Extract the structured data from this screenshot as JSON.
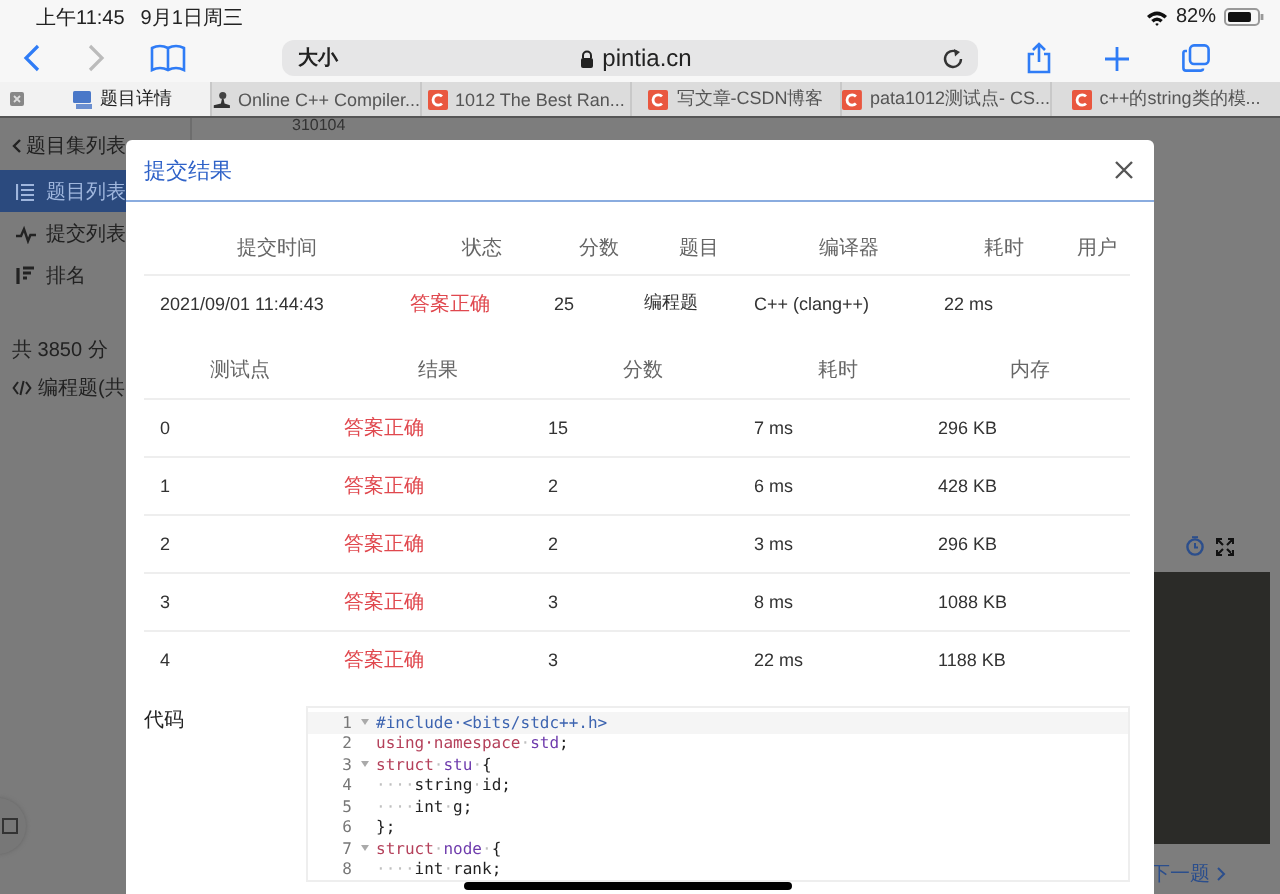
{
  "status_bar": {
    "time": "上午11:45",
    "date": "9月1日周三",
    "battery": "82%"
  },
  "browser": {
    "text_size": "大小",
    "address": "pintia.cn",
    "tabs": [
      {
        "title": "题目详情",
        "selected": true,
        "kind": "computer"
      },
      {
        "title": "Online C++ Compiler...",
        "selected": false,
        "kind": "figure"
      },
      {
        "title": "1012 The Best Ran...",
        "selected": false,
        "kind": "c"
      },
      {
        "title": "写文章-CSDN博客",
        "selected": false,
        "kind": "c"
      },
      {
        "title": "pata1012测试点- CS...",
        "selected": false,
        "kind": "c"
      },
      {
        "title": "c++的string类的模...",
        "selected": false,
        "kind": "c"
      }
    ]
  },
  "page": {
    "back_link": "题目集列表",
    "background_text": "310104",
    "sidebar": [
      {
        "label": "题目列表",
        "selected": true,
        "kind": "list"
      },
      {
        "label": "提交列表",
        "selected": false,
        "kind": "pulse"
      },
      {
        "label": "排名",
        "selected": false,
        "kind": "bars"
      }
    ],
    "total": "共 3850 分",
    "category": "编程题(共",
    "next": "下一题"
  },
  "modal": {
    "title": "提交结果",
    "summary": {
      "columns": [
        "提交时间",
        "状态",
        "分数",
        "题目",
        "编译器",
        "耗时",
        "用户"
      ],
      "row": [
        "2021/09/01 11:44:43",
        "答案正确",
        "25",
        "编程题",
        "C++ (clang++)",
        "22 ms"
      ]
    },
    "cases": {
      "columns": [
        "测试点",
        "结果",
        "分数",
        "耗时",
        "内存"
      ],
      "rows": [
        [
          "0",
          "答案正确",
          "15",
          "7 ms",
          "296 KB"
        ],
        [
          "1",
          "答案正确",
          "2",
          "6 ms",
          "428 KB"
        ],
        [
          "2",
          "答案正确",
          "2",
          "3 ms",
          "296 KB"
        ],
        [
          "3",
          "答案正确",
          "3",
          "8 ms",
          "1088 KB"
        ],
        [
          "4",
          "答案正确",
          "3",
          "22 ms",
          "1188 KB"
        ]
      ]
    },
    "code_label": "代码",
    "code": [
      {
        "number": "1",
        "foldable": true,
        "tokens": [
          {
            "kind": "directive",
            "text": "#include·<bits/stdc++.h>"
          }
        ]
      },
      {
        "number": "2",
        "foldable": false,
        "tokens": [
          {
            "kind": "keyword",
            "text": "using·namespace"
          },
          {
            "kind": "space",
            "text": "·"
          },
          {
            "kind": "name",
            "text": "std"
          },
          {
            "kind": "plain",
            "text": ";"
          }
        ]
      },
      {
        "number": "3",
        "foldable": true,
        "tokens": [
          {
            "kind": "keyword",
            "text": "struct"
          },
          {
            "kind": "space",
            "text": "·"
          },
          {
            "kind": "name",
            "text": "stu"
          },
          {
            "kind": "space",
            "text": "·"
          },
          {
            "kind": "plain",
            "text": "{"
          }
        ]
      },
      {
        "number": "4",
        "foldable": false,
        "tokens": [
          {
            "kind": "space",
            "text": "····"
          },
          {
            "kind": "plain",
            "text": "string"
          },
          {
            "kind": "space",
            "text": "·"
          },
          {
            "kind": "plain",
            "text": "id;"
          }
        ]
      },
      {
        "number": "5",
        "foldable": false,
        "tokens": [
          {
            "kind": "space",
            "text": "····"
          },
          {
            "kind": "plain",
            "text": "int"
          },
          {
            "kind": "space",
            "text": "·"
          },
          {
            "kind": "plain",
            "text": "g;"
          }
        ]
      },
      {
        "number": "6",
        "foldable": false,
        "tokens": [
          {
            "kind": "plain",
            "text": "};"
          }
        ]
      },
      {
        "number": "7",
        "foldable": true,
        "tokens": [
          {
            "kind": "keyword",
            "text": "struct"
          },
          {
            "kind": "space",
            "text": "·"
          },
          {
            "kind": "name",
            "text": "node"
          },
          {
            "kind": "space",
            "text": "·"
          },
          {
            "kind": "plain",
            "text": "{"
          }
        ]
      },
      {
        "number": "8",
        "foldable": false,
        "tokens": [
          {
            "kind": "space",
            "text": "····"
          },
          {
            "kind": "plain",
            "text": "int"
          },
          {
            "kind": "space",
            "text": "·"
          },
          {
            "kind": "plain",
            "text": "rank;"
          }
        ]
      }
    ]
  }
}
